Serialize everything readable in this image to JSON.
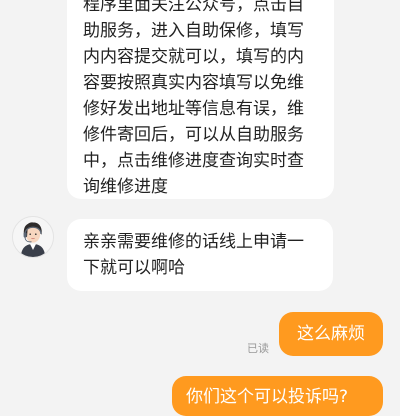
{
  "messages": [
    {
      "from": "agent",
      "lines": [
        "程序里面关注公众号，点击自",
        "助服务，进入自助保修，填写",
        "内内容提交就可以，填写的内",
        "容要按照真实内容填写以免维",
        "修好发出地址等信息有误，维",
        "修件寄回后，可以从自助服务",
        "中，点击维修进度查询实时查",
        "询维修进度"
      ]
    },
    {
      "from": "agent",
      "avatar_icon": "customer-service-agent-avatar",
      "lines": [
        "亲亲需要维修的话线上申请一",
        "下就可以啊哈"
      ]
    },
    {
      "from": "user",
      "text": "这么麻烦",
      "status": "已读"
    },
    {
      "from": "user",
      "text": "你们这个可以投诉吗?"
    }
  ],
  "colors": {
    "background": "#f3f3f3",
    "incoming_bubble": "#ffffff",
    "outgoing_bubble": "#ff9a1f",
    "read_status": "#999999"
  }
}
